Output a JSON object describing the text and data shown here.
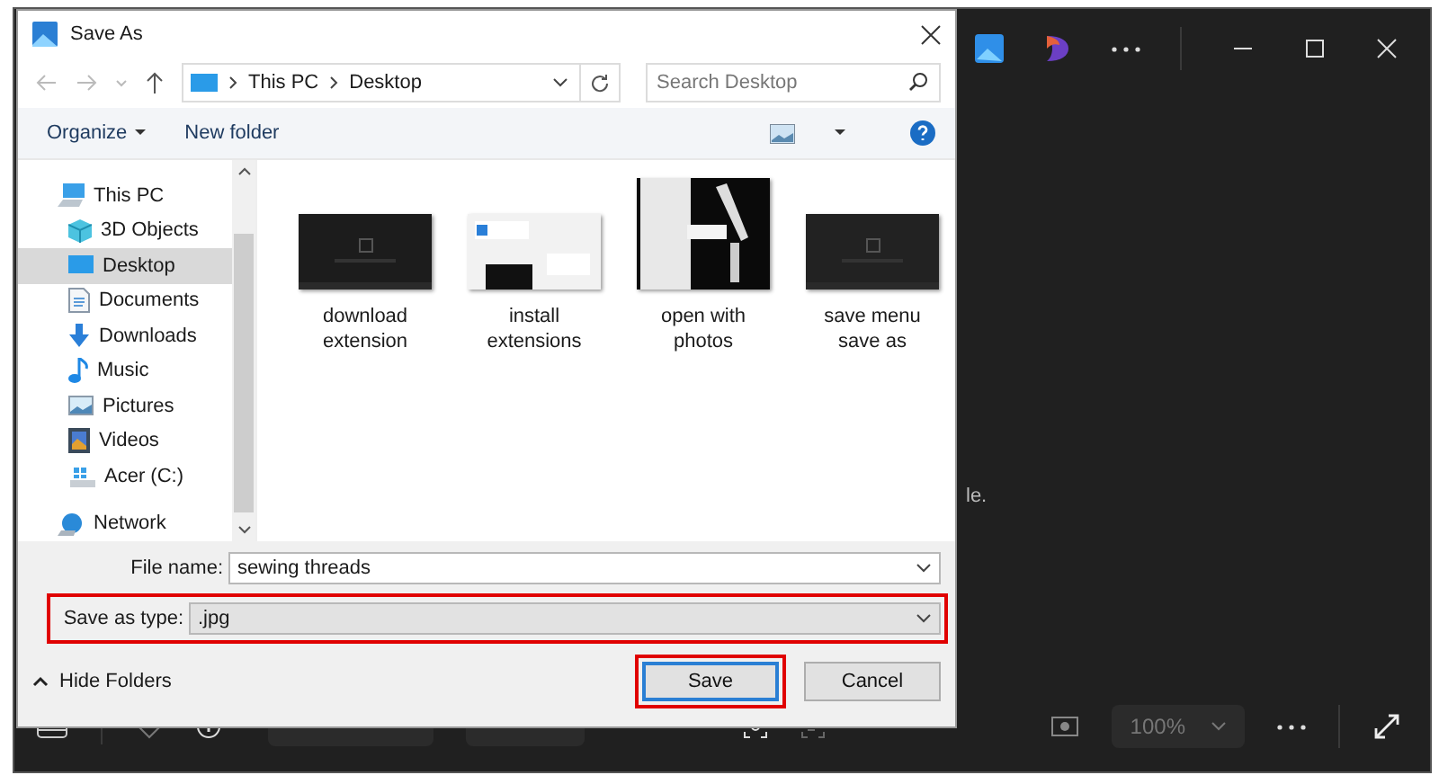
{
  "app": {
    "behind_text": "le.",
    "zoom": "100%"
  },
  "dialog": {
    "title": "Save As",
    "breadcrumb": [
      "This PC",
      "Desktop"
    ],
    "search": {
      "placeholder": "Search Desktop"
    },
    "toolbar": {
      "organize": "Organize",
      "new_folder": "New folder"
    },
    "sidebar": {
      "items": [
        {
          "label": "This PC",
          "kind": "pc",
          "selected": false,
          "children": [
            {
              "label": "3D Objects",
              "kind": "cube",
              "selected": false
            },
            {
              "label": "Desktop",
              "kind": "desktop",
              "selected": true
            },
            {
              "label": "Documents",
              "kind": "documents",
              "selected": false
            },
            {
              "label": "Downloads",
              "kind": "downloads",
              "selected": false
            },
            {
              "label": "Music",
              "kind": "music",
              "selected": false
            },
            {
              "label": "Pictures",
              "kind": "pictures",
              "selected": false
            },
            {
              "label": "Videos",
              "kind": "videos",
              "selected": false
            },
            {
              "label": "Acer (C:)",
              "kind": "drive",
              "selected": false
            }
          ]
        },
        {
          "label": "Network",
          "kind": "network",
          "selected": false
        }
      ]
    },
    "files": [
      {
        "name": "download extension"
      },
      {
        "name": "install extensions"
      },
      {
        "name": "open with photos"
      },
      {
        "name": "save menu save as"
      }
    ],
    "file_name": {
      "label": "File name:",
      "value": "sewing threads"
    },
    "save_as_type": {
      "label": "Save as type:",
      "value": ".jpg",
      "highlighted": true
    },
    "hide_folders": "Hide Folders",
    "buttons": [
      {
        "label": "Save",
        "default": true,
        "highlighted": true
      },
      {
        "label": "Cancel",
        "default": false,
        "highlighted": false
      }
    ]
  }
}
